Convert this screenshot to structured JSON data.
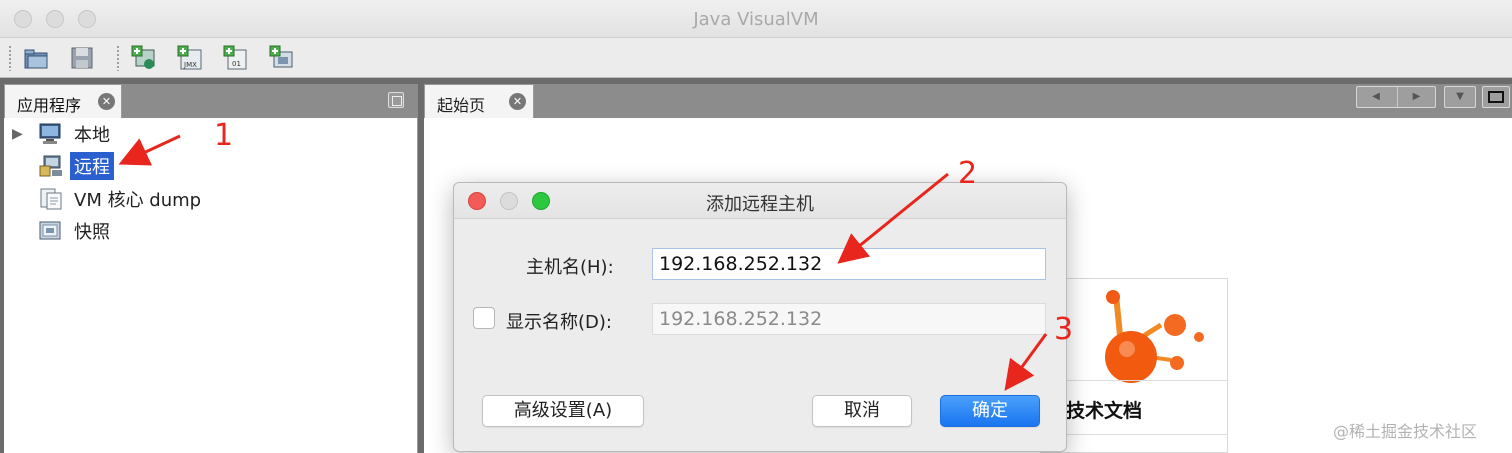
{
  "window": {
    "title": "Java VisualVM"
  },
  "toolbar": {
    "buttons": [
      {
        "icon": "open-folder-icon"
      },
      {
        "icon": "save-disk-icon"
      },
      {
        "icon": "add-application-icon"
      },
      {
        "icon": "add-jmx-connection-icon"
      },
      {
        "icon": "add-core-dump-icon"
      },
      {
        "icon": "add-snapshot-icon"
      }
    ]
  },
  "left_panel": {
    "tab_label": "应用程序",
    "tree": [
      {
        "label": "本地",
        "icon": "local-computer-icon"
      },
      {
        "label": "远程",
        "icon": "remote-host-icon",
        "selected": true
      },
      {
        "label": "VM 核心 dump",
        "icon": "vm-core-dump-icon"
      },
      {
        "label": "快照",
        "icon": "snapshot-icon"
      }
    ]
  },
  "right_panel": {
    "tab_label": "起始页",
    "card_title": "技术文档"
  },
  "dialog": {
    "title": "添加远程主机",
    "hostname_label": "主机名(H):",
    "hostname_value": "192.168.252.132",
    "display_name_label": "显示名称(D):",
    "display_name_value": "192.168.252.132",
    "advanced_button": "高级设置(A)",
    "cancel_button": "取消",
    "ok_button": "确定"
  },
  "annotations": {
    "step1": "1",
    "step2": "2",
    "step3": "3"
  },
  "watermark": "@稀土掘金技术社区",
  "colors": {
    "accent": "#1975f0",
    "selection": "#2a5fd0",
    "annotation": "#e8261e"
  }
}
